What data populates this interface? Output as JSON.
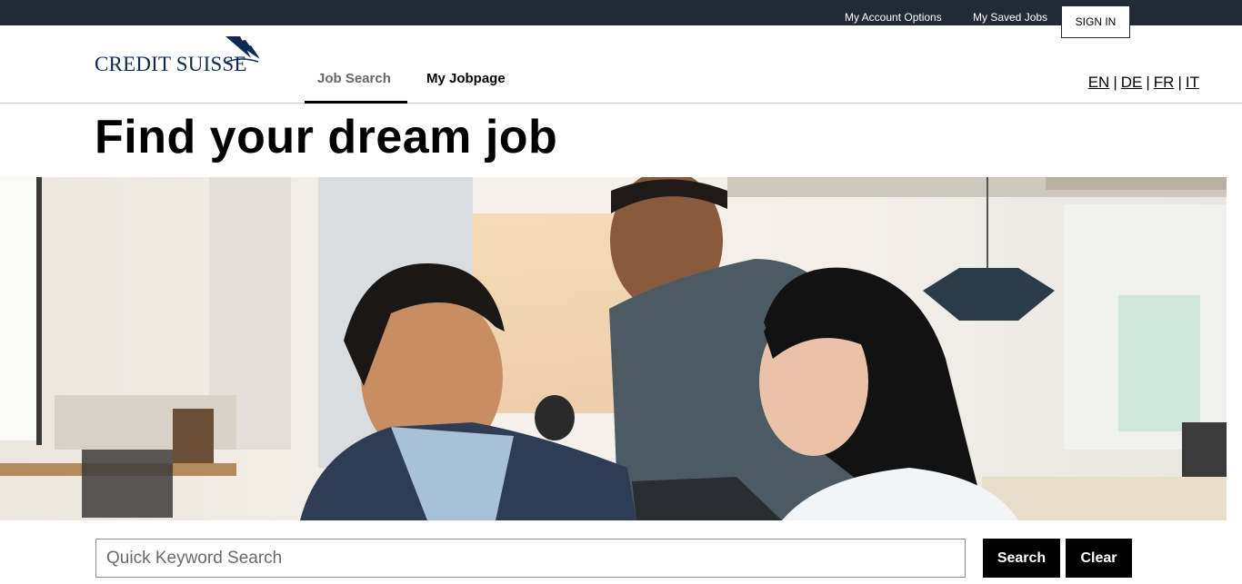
{
  "topbar": {
    "account_options": "My Account Options",
    "saved_jobs": "My Saved Jobs",
    "sign_in": "SIGN IN"
  },
  "brand": {
    "name": "CREDIT SUISSE",
    "color": "#0e2a52"
  },
  "nav": {
    "tabs": [
      {
        "label": "Job Search",
        "active": true
      },
      {
        "label": "My Jobpage",
        "active": false
      }
    ]
  },
  "languages": [
    "EN",
    "DE",
    "FR",
    "IT"
  ],
  "title": "Find your dream job",
  "search": {
    "placeholder": "Quick Keyword Search",
    "value": "",
    "search_label": "Search",
    "clear_label": "Clear"
  },
  "colors": {
    "topbar": "#222a35",
    "button": "#000000"
  }
}
